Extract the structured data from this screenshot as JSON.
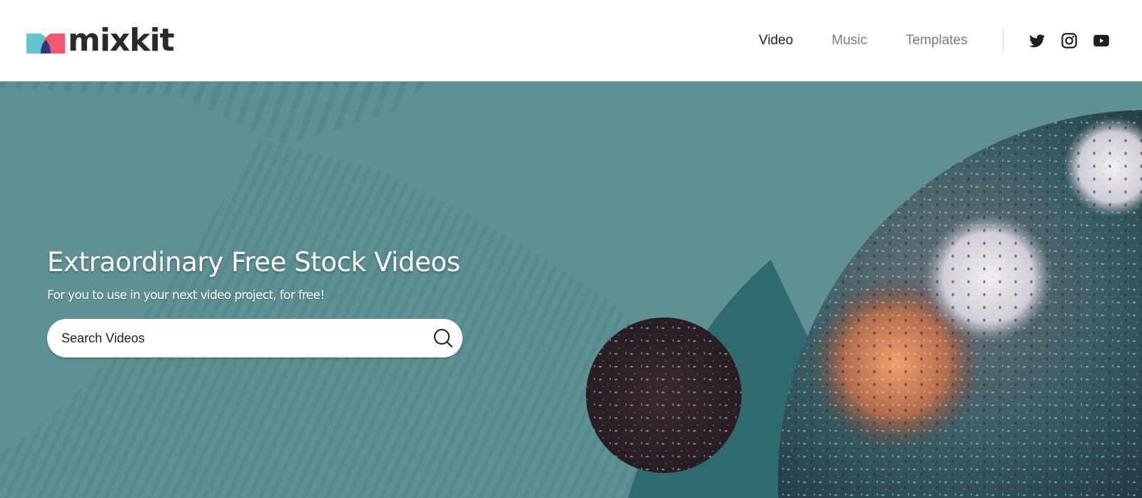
{
  "header": {
    "logo_text": "mixkit",
    "nav": [
      {
        "label": "Video",
        "active": true
      },
      {
        "label": "Music",
        "active": false
      },
      {
        "label": "Templates",
        "active": false
      }
    ],
    "social": [
      {
        "icon": "twitter-icon"
      },
      {
        "icon": "instagram-icon"
      },
      {
        "icon": "youtube-icon"
      }
    ]
  },
  "hero": {
    "title": "Extraordinary Free Stock Videos",
    "subtitle": "For you to use in your next video project, for free!",
    "search": {
      "placeholder": "Search Videos",
      "value": ""
    }
  },
  "colors": {
    "hero_bg": "#5f9194",
    "hero_dark": "#2f6a70",
    "logo_teal": "#5bc8d0",
    "logo_pink": "#f4566f",
    "logo_navy": "#2c3a7a"
  }
}
